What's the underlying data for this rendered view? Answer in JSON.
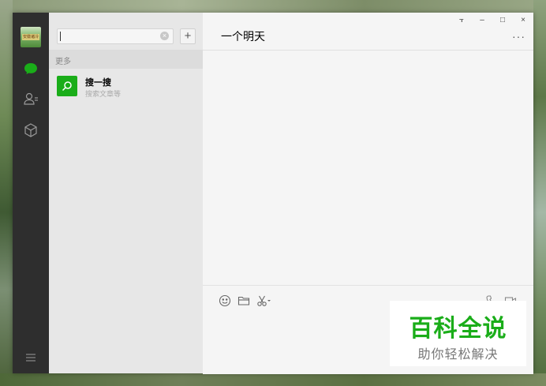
{
  "avatar": {
    "text": "安徽诸冷"
  },
  "search": {
    "value": "",
    "clear_icon": "×",
    "add_icon": "+"
  },
  "list": {
    "section_header": "更多",
    "items": [
      {
        "title": "搜一搜",
        "subtitle": "搜索文章等",
        "icon": "search-icon"
      }
    ]
  },
  "chat": {
    "title": "一个明天",
    "more_label": "···"
  },
  "window_controls": {
    "pin": "⫟",
    "minimize": "–",
    "maximize": "□",
    "close": "×"
  },
  "watermark": {
    "title": "百科全说",
    "subtitle": "助你轻松解决"
  },
  "colors": {
    "accent": "#1aad19",
    "sidebar": "#2e2e2e",
    "list_bg": "#e7e7e7",
    "chat_bg": "#f5f5f5"
  }
}
